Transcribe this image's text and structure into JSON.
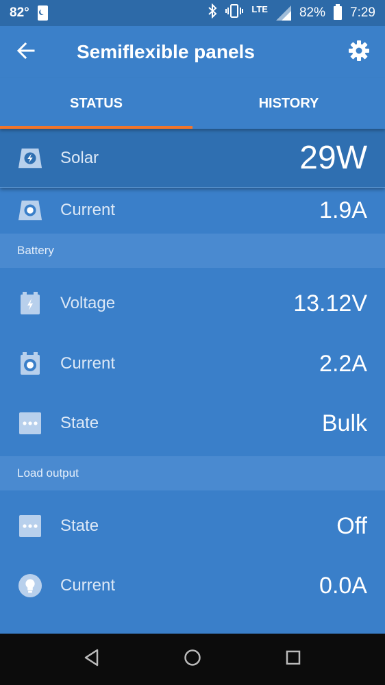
{
  "status_bar": {
    "temperature": "82°",
    "network": "LTE",
    "battery_percent": "82%",
    "time": "7:29",
    "icons": [
      "moon-notification-icon",
      "bluetooth-icon",
      "vibrate-icon",
      "signal-icon",
      "battery-icon"
    ]
  },
  "app_bar": {
    "title": "Semiflexible panels",
    "back_icon": "arrow-left-icon",
    "settings_icon": "gear-icon"
  },
  "tabs": [
    {
      "label": "STATUS",
      "active": true
    },
    {
      "label": "HISTORY",
      "active": false
    }
  ],
  "accent_color": "#f0752b",
  "solar": {
    "power": {
      "label": "Solar",
      "value": "29W",
      "icon": "solar-panel-icon"
    },
    "current": {
      "label": "Current",
      "value": "1.9A",
      "icon": "solar-current-icon"
    }
  },
  "battery": {
    "header": "Battery",
    "voltage": {
      "label": "Voltage",
      "value": "13.12V",
      "icon": "battery-voltage-icon"
    },
    "current": {
      "label": "Current",
      "value": "2.2A",
      "icon": "battery-current-icon"
    },
    "state": {
      "label": "State",
      "value": "Bulk",
      "icon": "dots-icon"
    }
  },
  "load_output": {
    "header": "Load output",
    "state": {
      "label": "State",
      "value": "Off",
      "icon": "dots-icon"
    },
    "current": {
      "label": "Current",
      "value": "0.0A",
      "icon": "lightbulb-icon"
    }
  },
  "nav_bar": {
    "icons": [
      "back-triangle-icon",
      "home-circle-icon",
      "recents-square-icon"
    ]
  }
}
